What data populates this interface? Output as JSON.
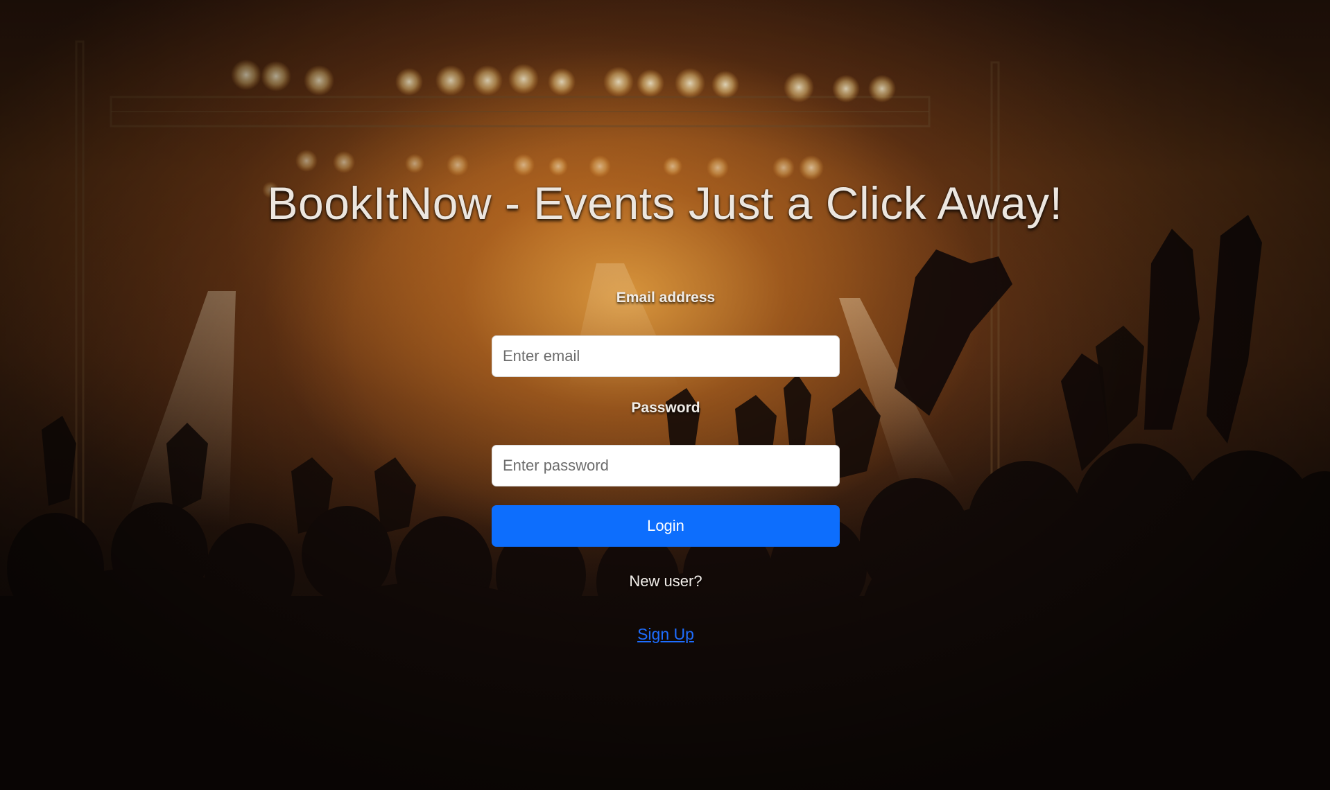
{
  "page": {
    "title": "BookItNow - Events Just a Click Away!"
  },
  "form": {
    "email_label": "Email address",
    "email_placeholder": "Enter email",
    "email_value": "",
    "password_label": "Password",
    "password_placeholder": "Enter password",
    "password_value": "",
    "login_label": "Login",
    "new_user_text": "New user?",
    "signup_label": "Sign Up"
  },
  "colors": {
    "accent": "#0d6efd",
    "link": "#1e6dff",
    "title_text": "#ece6df"
  },
  "background": {
    "description_icon": "concert-crowd-background-image"
  }
}
